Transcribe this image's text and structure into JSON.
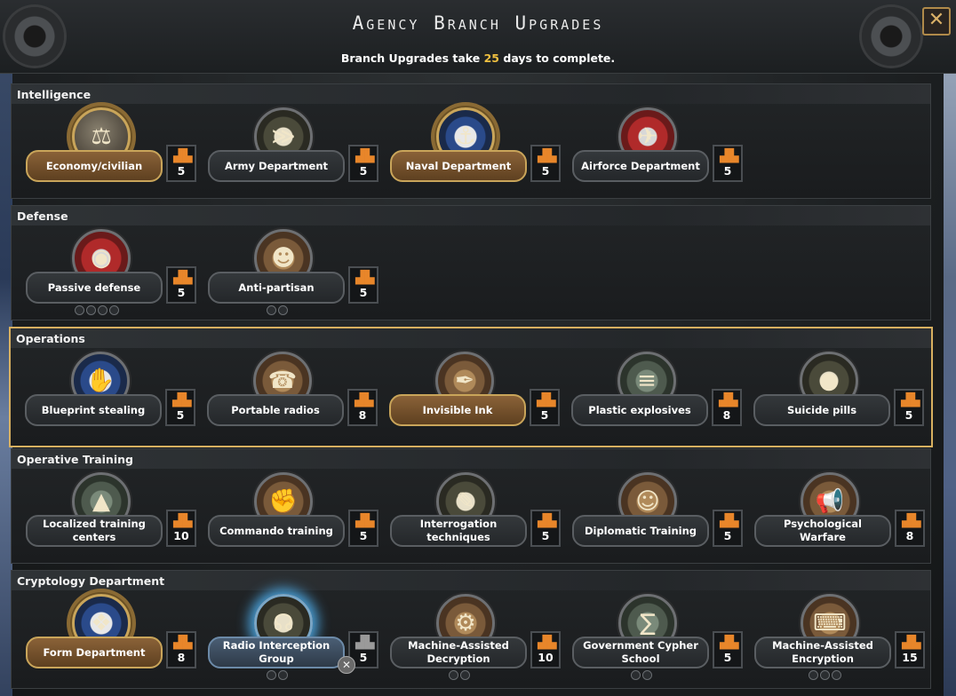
{
  "window": {
    "title": "Agency Branch Upgrades",
    "subtitle_prefix": "Branch Upgrades take",
    "subtitle_days": "25",
    "subtitle_suffix": "days to complete.",
    "close_icon": "✕"
  },
  "sections": [
    {
      "title": "Intelligence",
      "cards": [
        {
          "label": "Economy/civilian",
          "cost": "5",
          "icon": "scale-icon",
          "glyph": "⚖",
          "style": "gold"
        },
        {
          "label": "Army Department",
          "cost": "5",
          "icon": "chevron-rank-icon",
          "glyph": "≫",
          "style": "normal"
        },
        {
          "label": "Naval Department",
          "cost": "5",
          "icon": "anchor-icon",
          "glyph": "⚓",
          "style": "gold"
        },
        {
          "label": "Airforce Department",
          "cost": "5",
          "icon": "airplane-icon",
          "glyph": "✈",
          "style": "normal"
        }
      ]
    },
    {
      "title": "Defense",
      "cards": [
        {
          "label": "Passive defense",
          "cost": "5",
          "icon": "eye-shield-icon",
          "glyph": "◉",
          "style": "normal",
          "dots": 4
        },
        {
          "label": "Anti-partisan",
          "cost": "5",
          "icon": "partisan-icon",
          "glyph": "☻",
          "style": "normal",
          "dots": 2
        }
      ]
    },
    {
      "title": "Operations",
      "cards": [
        {
          "label": "Blueprint stealing",
          "cost": "5",
          "icon": "blueprint-icon",
          "glyph": "✋",
          "style": "normal"
        },
        {
          "label": "Portable radios",
          "cost": "8",
          "icon": "radio-icon",
          "glyph": "☎",
          "style": "normal"
        },
        {
          "label": "Invisible Ink",
          "cost": "5",
          "icon": "quill-icon",
          "glyph": "✒",
          "style": "gold"
        },
        {
          "label": "Plastic explosives",
          "cost": "8",
          "icon": "explosive-icon",
          "glyph": "≡",
          "style": "normal"
        },
        {
          "label": "Suicide pills",
          "cost": "5",
          "icon": "pill-icon",
          "glyph": "●",
          "style": "normal"
        }
      ]
    },
    {
      "title": "Operative Training",
      "cards": [
        {
          "label": "Localized training centers",
          "cost": "10",
          "icon": "training-center-icon",
          "glyph": "▲",
          "style": "normal"
        },
        {
          "label": "Commando training",
          "cost": "5",
          "icon": "commando-icon",
          "glyph": "✊",
          "style": "normal"
        },
        {
          "label": "Interrogation techniques",
          "cost": "5",
          "icon": "interrogation-icon",
          "glyph": "✎",
          "style": "normal"
        },
        {
          "label": "Diplomatic Training",
          "cost": "5",
          "icon": "diplomat-icon",
          "glyph": "☺",
          "style": "normal"
        },
        {
          "label": "Psychological Warfare",
          "cost": "8",
          "icon": "megaphone-icon",
          "glyph": "📢",
          "style": "normal"
        }
      ]
    },
    {
      "title": "Cryptology Department",
      "cards": [
        {
          "label": "Form Department",
          "cost": "8",
          "icon": "seal-icon",
          "glyph": "❖",
          "style": "gold"
        },
        {
          "label": "Radio Interception Group",
          "cost": "5",
          "icon": "radio-operator-icon",
          "glyph": "☊",
          "style": "blue",
          "dots": 2,
          "cancel": true
        },
        {
          "label": "Machine-Assisted Decryption",
          "cost": "10",
          "icon": "decryption-machine-icon",
          "glyph": "⚙",
          "style": "normal",
          "dots": 2
        },
        {
          "label": "Government Cypher School",
          "cost": "5",
          "icon": "cypher-icon",
          "glyph": "∑",
          "style": "normal",
          "dots": 2
        },
        {
          "label": "Machine-Assisted Encryption",
          "cost": "15",
          "icon": "enigma-icon",
          "glyph": "⌨",
          "style": "normal",
          "dots": 3
        }
      ]
    }
  ]
}
